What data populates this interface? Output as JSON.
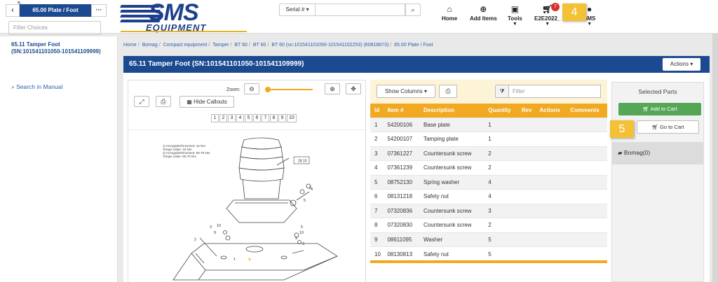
{
  "header": {
    "logo_main": "SMS",
    "logo_sub": "EQUIPMENT",
    "serial_dropdown": "Serial #",
    "nav": [
      {
        "label": "Home",
        "icon": "home-icon"
      },
      {
        "label": "Add Items",
        "icon": "plus-circle-icon"
      },
      {
        "label": "Tools",
        "icon": "toolbox-icon"
      },
      {
        "label": "E2E2022_",
        "icon": "cart-icon"
      },
      {
        "label": "SMS",
        "icon": "user-icon"
      }
    ],
    "cart_badge": "7",
    "callout_4": "4"
  },
  "left": {
    "title": "65.00 Plate / Foot",
    "filter_placeholder": "Filter Choices",
    "item": "65.11 Tamper Foot (SN:101541101050-101541109999)",
    "search_manual": "Search in Manual"
  },
  "breadcrumb": [
    "Home",
    "Bomag",
    "Compact equipment",
    "Tamper",
    "BT 60",
    "BT 60",
    "BT 60 (sn:101541101050-101541102253) (60818673)",
    "65.00 Plate / Foot"
  ],
  "main": {
    "title": "65.11 Tamper Foot (SN:101541101050-101541109999)",
    "actions": "Actions"
  },
  "viewer": {
    "zoom_label": "Zoom:",
    "hide_callouts": "Hide Callouts",
    "pages": [
      "1",
      "2",
      "3",
      "4",
      "5",
      "6",
      "7",
      "8",
      "9",
      "10"
    ],
    "notes": [
      "1) Anzugsdrehmoment: 15 Nm",
      "Torque value: 15 Nm",
      "2) Anzugsdrehmoment: 65-75 Nm",
      "Torque value: 65-70 Nm"
    ],
    "drawing_labels": [
      "28.10",
      "5",
      "6",
      "2",
      "1",
      "4",
      "5",
      "10",
      "9",
      "3",
      "10",
      "3",
      "9"
    ]
  },
  "parts": {
    "show_columns": "Show Columns",
    "filter_placeholder": "Filter",
    "columns": [
      "Id",
      "Item #",
      "Description",
      "Quantity",
      "Rev",
      "Actions",
      "Comments"
    ],
    "rows": [
      [
        "1",
        "54200106",
        "Base plate",
        "1"
      ],
      [
        "2",
        "54200107",
        "Tamping plate",
        "1"
      ],
      [
        "3",
        "07361227",
        "Countersunk screw",
        "2"
      ],
      [
        "4",
        "07361239",
        "Countersunk screw",
        "2"
      ],
      [
        "5",
        "08752130",
        "Spring washer",
        "4"
      ],
      [
        "6",
        "08131218",
        "Safety nut",
        "4"
      ],
      [
        "7",
        "07320836",
        "Countersunk screw",
        "3"
      ],
      [
        "8",
        "07320830",
        "Countersunk screw",
        "2"
      ],
      [
        "9",
        "08611095",
        "Washer",
        "5"
      ],
      [
        "10",
        "08130813",
        "Safety nut",
        "5"
      ]
    ]
  },
  "selected": {
    "title": "Selected Parts",
    "add_to_cart": "Add to Cart",
    "go_to_cart": "Go to Cart",
    "group": "Bomag(0)",
    "callout_5": "5"
  }
}
